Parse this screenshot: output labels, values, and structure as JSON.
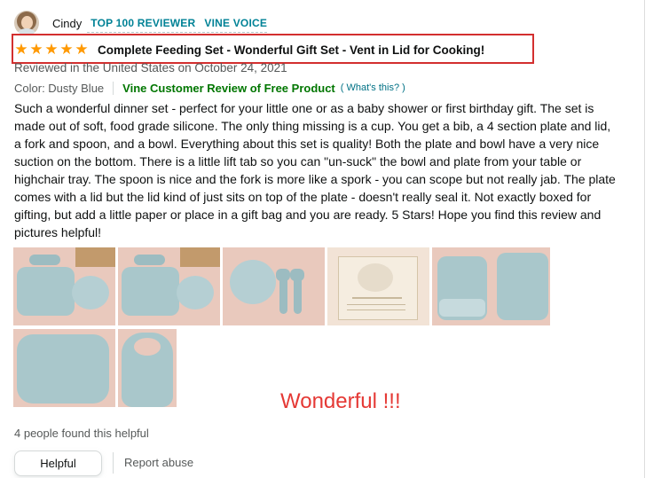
{
  "reviewer": {
    "name": "Cindy",
    "badges": [
      "TOP 100 REVIEWER",
      "VINE VOICE"
    ]
  },
  "review": {
    "rating": 5,
    "title": "Complete Feeding Set - Wonderful Gift Set - Vent in Lid for Cooking!",
    "date_line": "Reviewed in the United States on October 24, 2021",
    "color_label": "Color: Dusty Blue",
    "vine_label": "Vine Customer Review of Free Product",
    "whats_this": "What's this?",
    "body": "Such a wonderful dinner set - perfect for your little one or as a baby shower or first birthday gift. The set is made out of soft, food grade silicone. The only thing missing is a cup. You get a bib, a 4 section plate and lid, a fork and spoon, and a bowl. Everything about this set is quality! Both the plate and bowl have a very nice suction on the bottom. There is a little lift tab so you can \"un-suck\" the bowl and plate from your table or highchair tray. The spoon is nice and the fork is more like a spork - you can scope but not really jab. The plate comes with a lid but the lid kind of just sits on top of the plate - doesn't really seal it. Not exactly boxed for gifting, but add a little paper or place in a gift bag and you are ready. 5 Stars! Hope you find this review and pictures helpful!",
    "annotation": "Wonderful !!!"
  },
  "footer": {
    "helpful_count": "4 people found this helpful",
    "helpful_button": "Helpful",
    "report_abuse": "Report abuse"
  },
  "colors": {
    "star": "#ff9900",
    "badge": "#008296",
    "vine": "#007600",
    "link": "#007185",
    "highlight_border": "#d32f2f",
    "annotation": "#e53935"
  },
  "icons": {
    "star": "star-icon",
    "avatar": "reviewer-avatar"
  }
}
